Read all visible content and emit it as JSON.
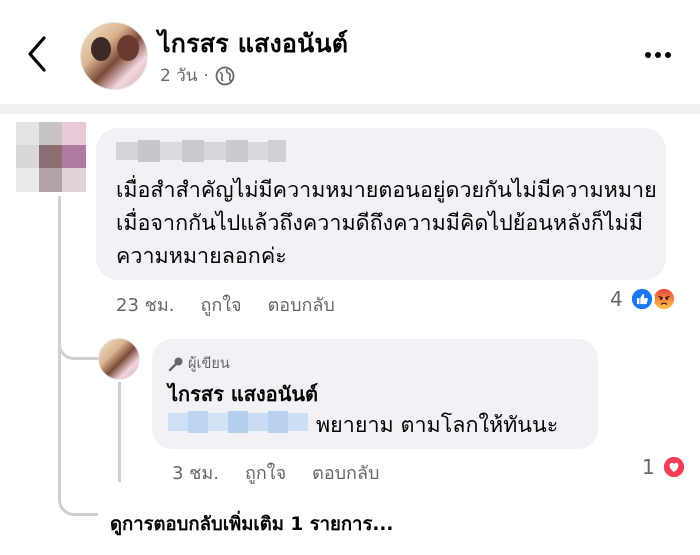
{
  "header": {
    "page_name": "ไกรสร แสงอนันต์",
    "post_time": "2 วัน",
    "separator": "·",
    "back_icon": "chevron-left-icon",
    "more_icon": "more-dots-icon",
    "audience_icon": "globe-icon"
  },
  "comment": {
    "text": "เมื่อสำสำคัญไม่มีความหมายตอนอยู่ดวยกันไม่มีความหมายเมื่อจากกันไปแล้วถึงความดีถึงความมีคิดไปย้อนหลังก็ไม่มีความหมายลอกค่ะ",
    "time": "23 ชม.",
    "like_label": "ถูกใจ",
    "reply_label": "ตอบกลับ",
    "reaction_count": "4",
    "reaction_icons": [
      "like-icon",
      "angry-icon"
    ]
  },
  "reply": {
    "author_badge": "ผู้เขียน",
    "author_name": "ไกรสร แสงอนันต์",
    "text": "พยายาม ตามโลกให้ทันนะ",
    "time": "3 ชม.",
    "like_label": "ถูกใจ",
    "reply_label": "ตอบกลับ",
    "reaction_count": "1",
    "reaction_icons": [
      "love-icon"
    ]
  },
  "more_replies_label": "ดูการตอบกลับเพิ่มเติม 1 รายการ...",
  "colors": {
    "bubble": "#f0f2f5",
    "secondary_text": "#65676b",
    "like_blue": "#1877f2",
    "love_red": "#f33e58",
    "angry_orange": "#f7714c"
  }
}
